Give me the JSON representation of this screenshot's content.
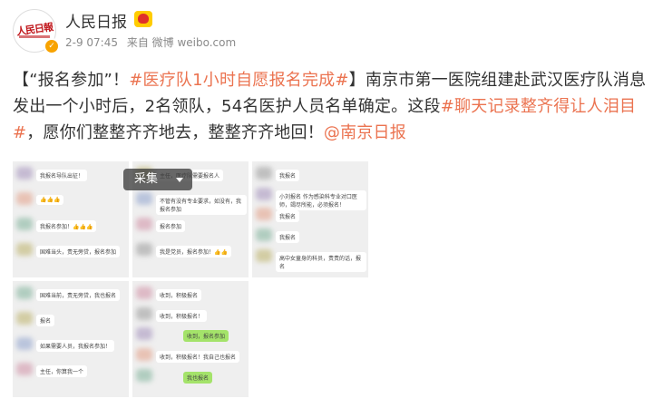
{
  "account": {
    "name": "人民日报",
    "avatar_text": "人民日報",
    "meta_time": "2-9 07:45",
    "meta_source": "来自 微博 weibo.com"
  },
  "post": {
    "segments": [
      {
        "text": "【“报名参加”！",
        "tag": false
      },
      {
        "text": "#医疗队1小时自愿报名完成#",
        "tag": true
      },
      {
        "text": "】南京市第一医院组建赴武汉医疗队消息发出一个小时后，2名领队，54名医护人员名单确定。这段",
        "tag": false
      },
      {
        "text": "#聊天记录整齐得让人泪目#",
        "tag": true
      },
      {
        "text": "，愿你们整整齐齐地去，整整齐齐地回！",
        "tag": false
      },
      {
        "text": "@南京日报",
        "tag": true
      }
    ]
  },
  "images": {
    "collect_label": "采集",
    "thumbs": [
      {
        "bubbles": [
          "我报名导队出征！",
          "👍👍👍",
          "我报名参加！👍👍👍",
          "国难当头，责无旁贷，报名参加"
        ]
      },
      {
        "bubbles": [
          "主任，医疗队需要报名人",
          "不管有没有专业要求，如没有，我报名参加",
          "报名参加",
          "我是党员，报名参加！👍👍"
        ]
      },
      {
        "bubbles": [
          "我报名",
          "小刘报名 作为感染科专业对口医师，竭尽所能，必须报名！",
          "我报名",
          "我报名",
          "高中女童身的科员，责责的话，报名"
        ]
      },
      {
        "bubbles": [
          "国难当前，责无旁贷，我也报名",
          "报名",
          "如果需要人员，我报名参加！",
          "主任，你算我一个"
        ]
      },
      {
        "bubbles": [
          "收到，积极报名",
          "收到，积极报名！",
          "收到，报名参加",
          "收到，积极报名！我自己也报名",
          "我也报名"
        ]
      }
    ]
  },
  "colors": {
    "tag": "#eb7350",
    "bubble_green": "#a4e36a",
    "badge": "#f8a300"
  }
}
